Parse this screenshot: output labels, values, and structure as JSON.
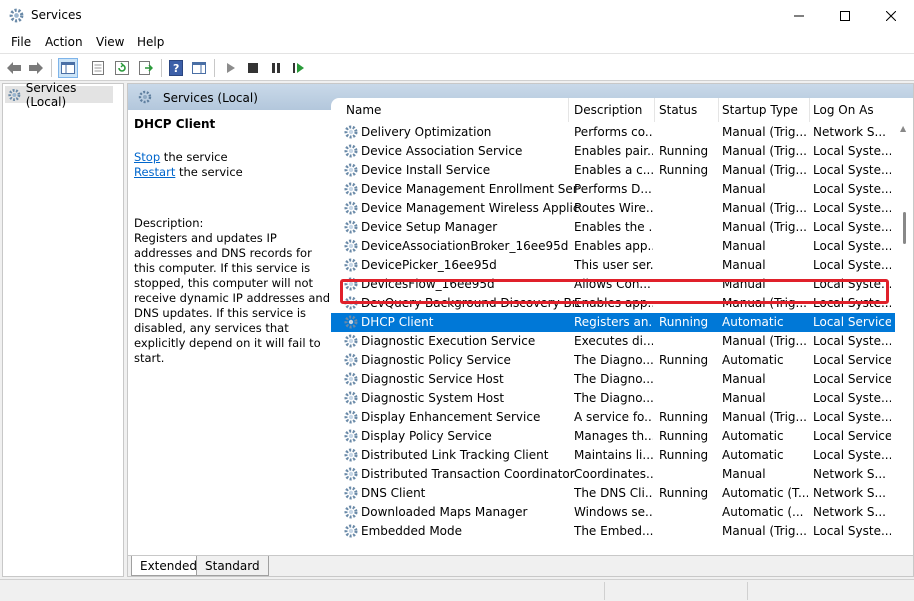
{
  "window": {
    "title": "Services"
  },
  "menu": [
    "File",
    "Action",
    "View",
    "Help"
  ],
  "tree": {
    "root": "Services (Local)"
  },
  "header": {
    "title": "Services (Local)"
  },
  "detail": {
    "service_name": "DHCP Client",
    "stop_link": "Stop",
    "stop_rest": " the service",
    "restart_link": "Restart",
    "restart_rest": " the service",
    "description_label": "Description:",
    "description": "Registers and updates IP addresses and DNS records for this computer. If this service is stopped, this computer will not receive dynamic IP addresses and DNS updates. If this service is disabled, any services that explicitly depend on it will fail to start."
  },
  "columns": [
    "Name",
    "Description",
    "Status",
    "Startup Type",
    "Log On As"
  ],
  "rows": [
    {
      "name": "Delivery Optimization",
      "description": "Performs co...",
      "status": "",
      "startup": "Manual (Trig...",
      "logon": "Network S..."
    },
    {
      "name": "Device Association Service",
      "description": "Enables pair...",
      "status": "Running",
      "startup": "Manual (Trig...",
      "logon": "Local Syste..."
    },
    {
      "name": "Device Install Service",
      "description": "Enables a c...",
      "status": "Running",
      "startup": "Manual (Trig...",
      "logon": "Local Syste..."
    },
    {
      "name": "Device Management Enrollment Serv...",
      "description": "Performs D...",
      "status": "",
      "startup": "Manual",
      "logon": "Local Syste..."
    },
    {
      "name": "Device Management Wireless Applic...",
      "description": "Routes Wire...",
      "status": "",
      "startup": "Manual (Trig...",
      "logon": "Local Syste..."
    },
    {
      "name": "Device Setup Manager",
      "description": "Enables the ...",
      "status": "",
      "startup": "Manual (Trig...",
      "logon": "Local Syste..."
    },
    {
      "name": "DeviceAssociationBroker_16ee95d",
      "description": "Enables app...",
      "status": "",
      "startup": "Manual",
      "logon": "Local Syste..."
    },
    {
      "name": "DevicePicker_16ee95d",
      "description": "This user ser...",
      "status": "",
      "startup": "Manual",
      "logon": "Local Syste..."
    },
    {
      "name": "DevicesFlow_16ee95d",
      "description": "Allows Con...",
      "status": "",
      "startup": "Manual",
      "logon": "Local Syste..."
    },
    {
      "name": "DevQuery Background Discovery Bro...",
      "description": "Enables app...",
      "status": "",
      "startup": "Manual (Trig...",
      "logon": "Local Syste..."
    },
    {
      "name": "DHCP Client",
      "description": "Registers an...",
      "status": "Running",
      "startup": "Automatic",
      "logon": "Local Service"
    },
    {
      "name": "Diagnostic Execution Service",
      "description": "Executes di...",
      "status": "",
      "startup": "Manual (Trig...",
      "logon": "Local Syste..."
    },
    {
      "name": "Diagnostic Policy Service",
      "description": "The Diagno...",
      "status": "Running",
      "startup": "Automatic",
      "logon": "Local Service"
    },
    {
      "name": "Diagnostic Service Host",
      "description": "The Diagno...",
      "status": "",
      "startup": "Manual",
      "logon": "Local Service"
    },
    {
      "name": "Diagnostic System Host",
      "description": "The Diagno...",
      "status": "",
      "startup": "Manual",
      "logon": "Local Syste..."
    },
    {
      "name": "Display Enhancement Service",
      "description": "A service fo...",
      "status": "Running",
      "startup": "Manual (Trig...",
      "logon": "Local Syste..."
    },
    {
      "name": "Display Policy Service",
      "description": "Manages th...",
      "status": "Running",
      "startup": "Automatic",
      "logon": "Local Service"
    },
    {
      "name": "Distributed Link Tracking Client",
      "description": "Maintains li...",
      "status": "Running",
      "startup": "Automatic",
      "logon": "Local Syste..."
    },
    {
      "name": "Distributed Transaction Coordinator",
      "description": "Coordinates...",
      "status": "",
      "startup": "Manual",
      "logon": "Network S..."
    },
    {
      "name": "DNS Client",
      "description": "The DNS Cli...",
      "status": "Running",
      "startup": "Automatic (T...",
      "logon": "Network S..."
    },
    {
      "name": "Downloaded Maps Manager",
      "description": "Windows se...",
      "status": "",
      "startup": "Automatic (...",
      "logon": "Network S..."
    },
    {
      "name": "Embedded Mode",
      "description": "The Embed...",
      "status": "",
      "startup": "Manual (Trig...",
      "logon": "Local Syste..."
    }
  ],
  "selected_row": "DHCP Client",
  "tabs": [
    "Extended",
    "Standard"
  ],
  "colors": {
    "selection": "#0078d7",
    "highlight": "#e0202a",
    "link": "#0066cc"
  }
}
